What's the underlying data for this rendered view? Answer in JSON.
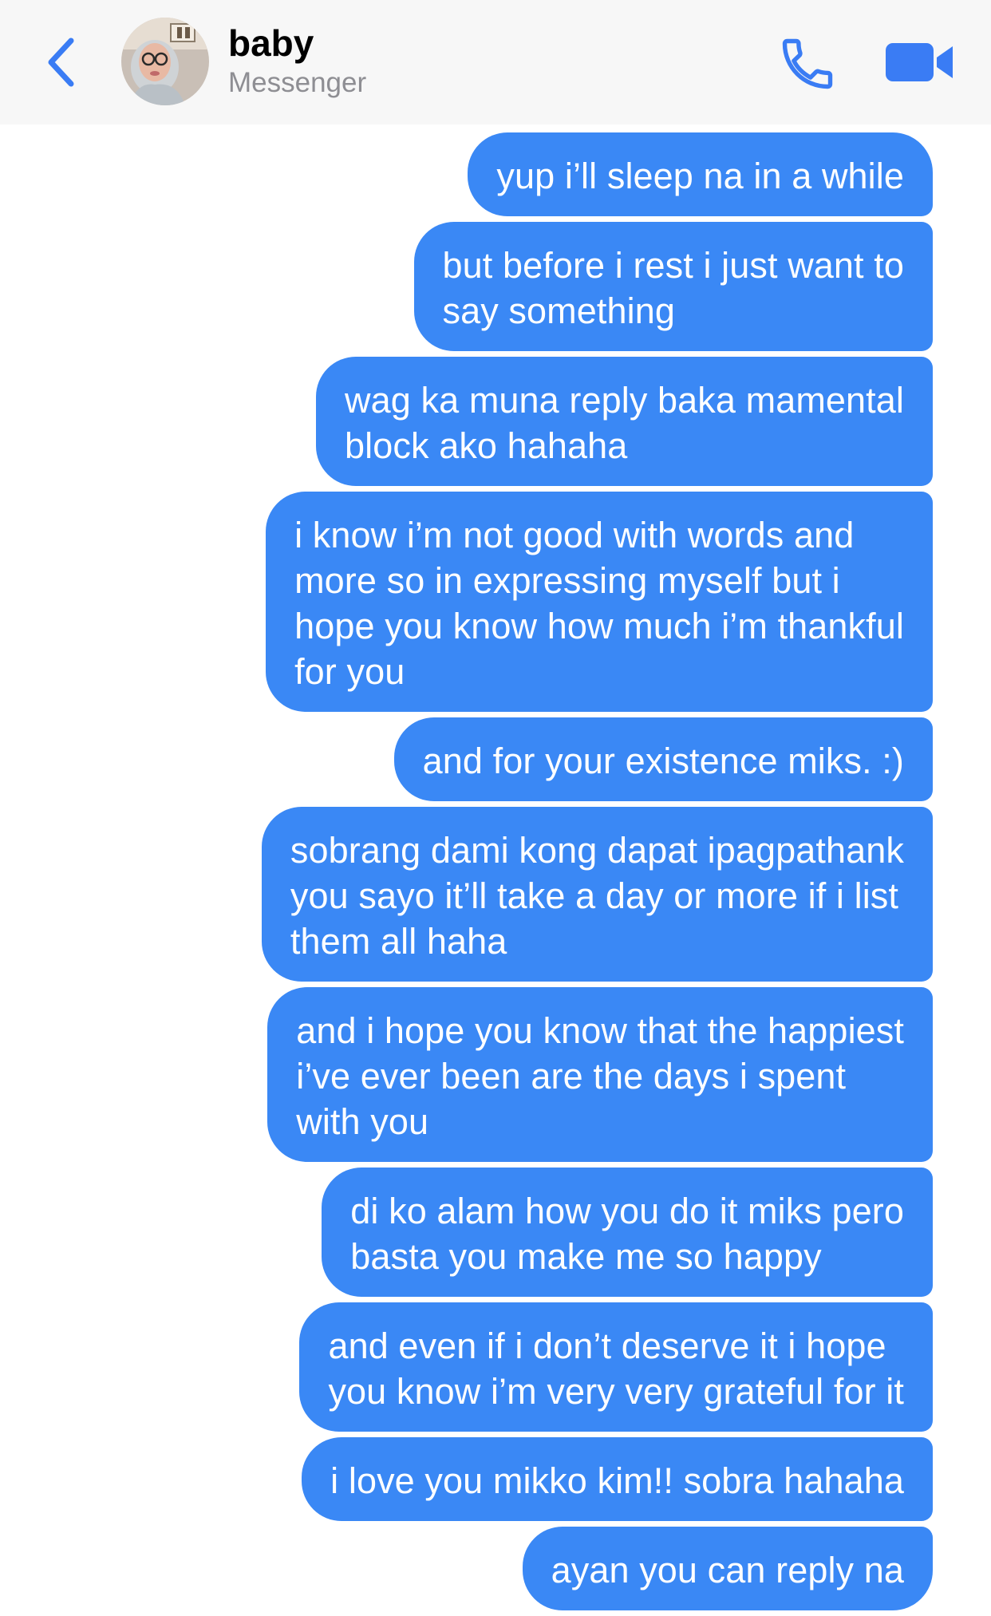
{
  "header": {
    "back_icon": "chevron-left-icon",
    "contact_name": "baby",
    "contact_subtitle": "Messenger",
    "call_icon": "phone-icon",
    "video_icon": "video-camera-icon",
    "accent_color": "#3a7cf4"
  },
  "thread": {
    "bubble_color": "#3a88f5",
    "messages": [
      "yup i’ll sleep na in a while",
      "but before i rest i just want to\nsay something",
      "wag ka muna reply baka mamental\nblock ako hahaha",
      "i know i’m not good with words and\nmore so in expressing myself but i\nhope you know how much i’m thankful\nfor you",
      "and for your existence miks. :)",
      "sobrang dami kong dapat ipagpathank\nyou sayo it’ll take a day or more if i list\nthem all haha",
      "and i hope you know that the happiest\ni’ve ever been are the days i spent\nwith you",
      "di ko alam how you do it miks pero\nbasta you make me so happy",
      "and even if i don’t deserve it i hope\nyou know i’m very very grateful for it",
      "i love you mikko kim!! sobra hahaha",
      "ayan you can reply na"
    ]
  }
}
